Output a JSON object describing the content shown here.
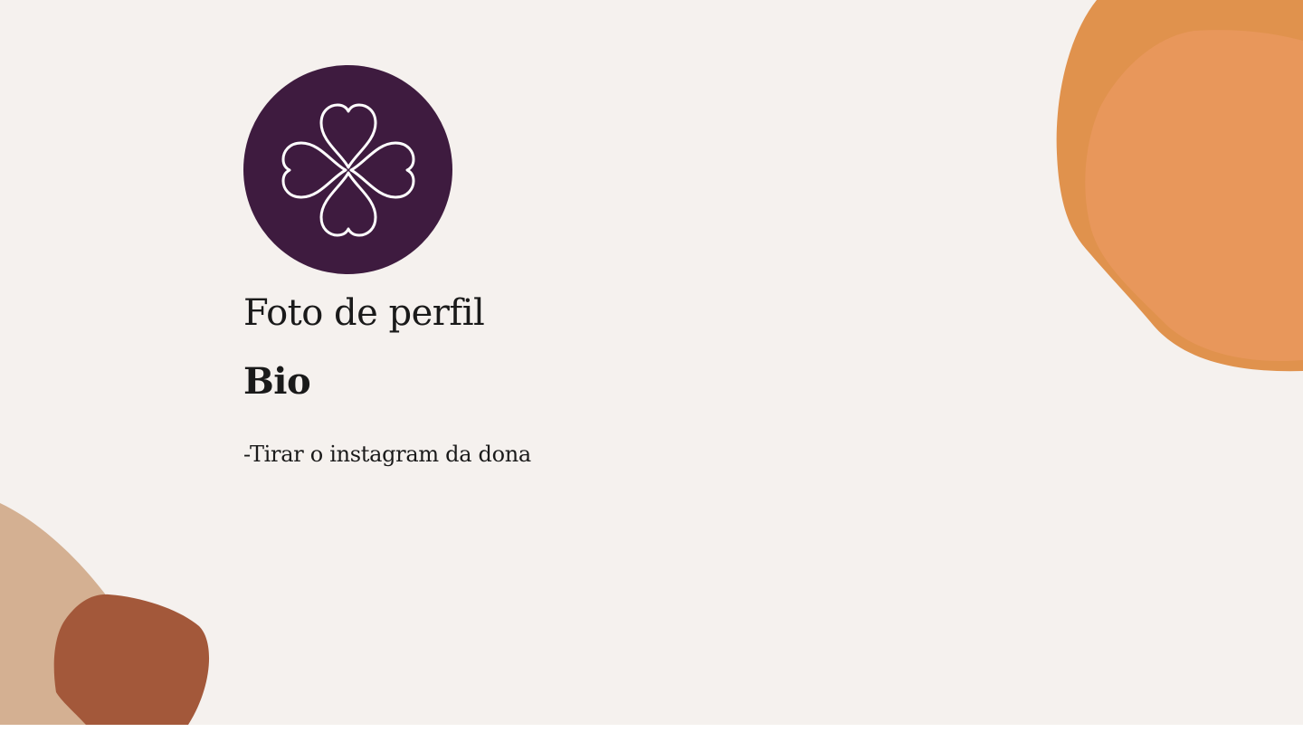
{
  "slide": {
    "title": "Foto de perfil",
    "subtitle": "Bio",
    "note": "-Tirar o instagram da dona"
  },
  "avatar": {
    "icon": "clover-hearts-icon",
    "background": "#3e1b3f",
    "icon_color": "#ffffff"
  },
  "colors": {
    "background": "#f5f1ee",
    "orange_dark": "#e0924d",
    "orange_light": "#e8975b",
    "tan": "#d4b092",
    "rust": "#a3583a"
  }
}
